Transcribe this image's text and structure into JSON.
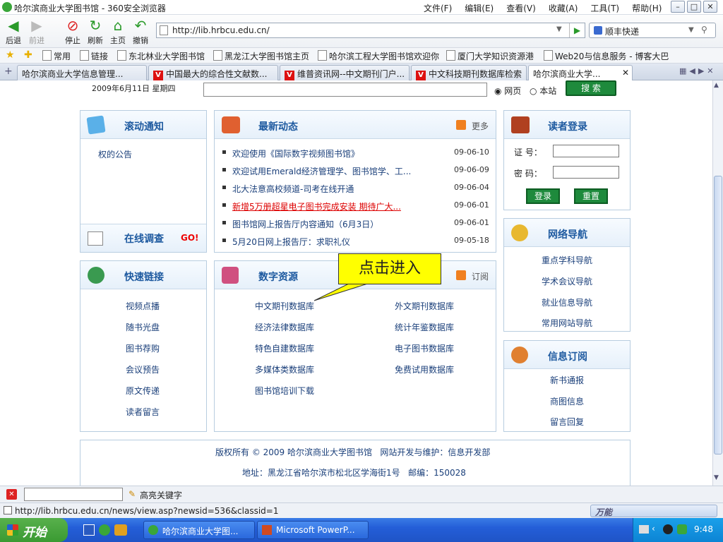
{
  "window": {
    "title": "哈尔滨商业大学图书馆 - 360安全浏览器",
    "menus": [
      "文件(F)",
      "编辑(E)",
      "查看(V)",
      "收藏(A)",
      "工具(T)",
      "帮助(H)"
    ]
  },
  "toolbar": {
    "buttons": [
      "后退",
      "前进",
      "停止",
      "刷新",
      "主页",
      "撤销"
    ],
    "address": "http://lib.hrbcu.edu.cn/",
    "search_engine": "顺丰快递"
  },
  "favorites": [
    "常用",
    "链接",
    "东北林业大学图书馆",
    "黑龙江大学图书馆主页",
    "哈尔滨工程大学图书馆欢迎你",
    "厦门大学知识资源港",
    "Web20与信息服务 - 博客大巴"
  ],
  "tabs": [
    "哈尔滨商业大学信息管理...",
    "中国最大的综合性文献数...",
    "维普资讯网--中文期刊门户...",
    "中文科技期刊数据库检索",
    "哈尔滨商业大学..."
  ],
  "page": {
    "date": "2009年6月11日 星期四",
    "radio_web": "网页",
    "radio_site": "本站",
    "search_button": "搜 索",
    "notice": {
      "title": "滚动通知",
      "text": "权的公告"
    },
    "survey": {
      "title": "在线调查",
      "go": "GO!"
    },
    "news": {
      "title": "最新动态",
      "more": "更多",
      "items": [
        {
          "text": "欢迎使用《国际数字视频图书馆》",
          "date": "09-06-10"
        },
        {
          "text": "欢迎试用Emerald经济管理学、图书馆学、工...",
          "date": "09-06-09"
        },
        {
          "text": "北大法意高校频道-司考在线开通",
          "date": "09-06-04"
        },
        {
          "text": "新增5万册超星电子图书完成安装 期待广大...",
          "date": "09-06-01"
        },
        {
          "text": "图书馆网上报告厅内容通知（6月3日）",
          "date": "09-06-01"
        },
        {
          "text": "5月20日网上报告厅：求职礼仪",
          "date": "09-05-18"
        }
      ]
    },
    "login": {
      "title": "读者登录",
      "id_label": "证 号：",
      "pw_label": "密 码：",
      "login": "登录",
      "reset": "重置"
    },
    "nav": {
      "title": "网络导航",
      "items": [
        "重点学科导航",
        "学术会议导航",
        "就业信息导航",
        "常用网站导航"
      ]
    },
    "quick": {
      "title": "快速链接",
      "items": [
        "视频点播",
        "随书光盘",
        "图书荐购",
        "会议预告",
        "原文传递",
        "读者留言"
      ]
    },
    "resources": {
      "title": "数字资源",
      "subscribe": "订阅",
      "left": [
        "中文期刊数据库",
        "经济法律数据库",
        "特色自建数据库",
        "多媒体类数据库",
        "图书馆培训下载"
      ],
      "right": [
        "外文期刊数据库",
        "统计年鉴数据库",
        "电子图书数据库",
        "免费试用数据库"
      ]
    },
    "info": {
      "title": "信息订阅",
      "items": [
        "新书通报",
        "商图信息",
        "留言回复"
      ]
    },
    "footer": {
      "line1": "版权所有 © 2009 哈尔滨商业大学图书馆   网站开发与维护：信息开发部",
      "line2": "地址：黑龙江省哈尔滨市松北区学海街1号   邮编：150028"
    },
    "callout": "点击进入"
  },
  "findbar": {
    "highlight": "高亮关键字"
  },
  "status": {
    "url": "http://lib.hrbcu.edu.cn/news/view.asp?newsid=536&classid=1",
    "right": "万能"
  },
  "taskbar": {
    "start": "开始",
    "tasks": [
      "哈尔滨商业大学图...",
      "Microsoft PowerP..."
    ],
    "time": "9:48"
  }
}
